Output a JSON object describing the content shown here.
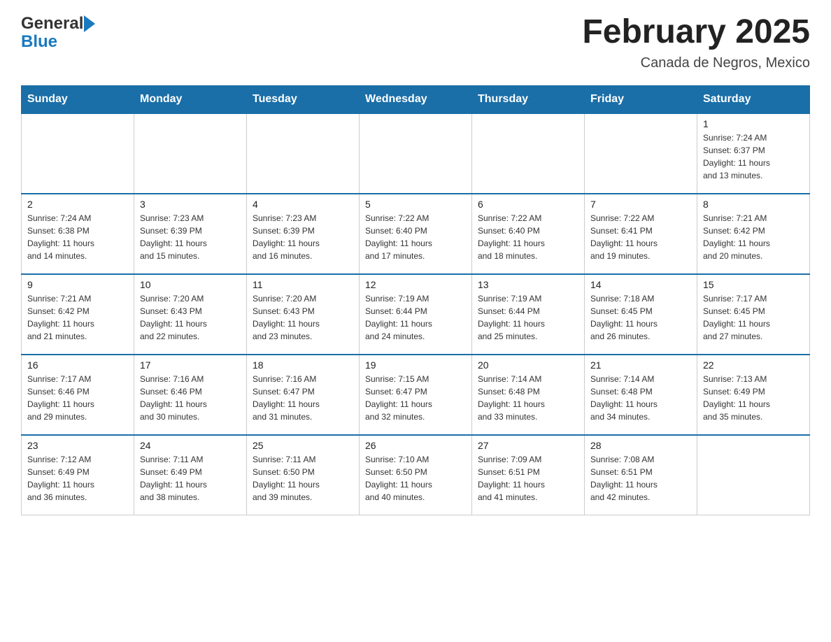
{
  "header": {
    "logo": {
      "general": "General",
      "blue": "Blue"
    },
    "title": "February 2025",
    "location": "Canada de Negros, Mexico"
  },
  "weekdays": [
    "Sunday",
    "Monday",
    "Tuesday",
    "Wednesday",
    "Thursday",
    "Friday",
    "Saturday"
  ],
  "weeks": [
    [
      {
        "day": "",
        "info": ""
      },
      {
        "day": "",
        "info": ""
      },
      {
        "day": "",
        "info": ""
      },
      {
        "day": "",
        "info": ""
      },
      {
        "day": "",
        "info": ""
      },
      {
        "day": "",
        "info": ""
      },
      {
        "day": "1",
        "info": "Sunrise: 7:24 AM\nSunset: 6:37 PM\nDaylight: 11 hours\nand 13 minutes."
      }
    ],
    [
      {
        "day": "2",
        "info": "Sunrise: 7:24 AM\nSunset: 6:38 PM\nDaylight: 11 hours\nand 14 minutes."
      },
      {
        "day": "3",
        "info": "Sunrise: 7:23 AM\nSunset: 6:39 PM\nDaylight: 11 hours\nand 15 minutes."
      },
      {
        "day": "4",
        "info": "Sunrise: 7:23 AM\nSunset: 6:39 PM\nDaylight: 11 hours\nand 16 minutes."
      },
      {
        "day": "5",
        "info": "Sunrise: 7:22 AM\nSunset: 6:40 PM\nDaylight: 11 hours\nand 17 minutes."
      },
      {
        "day": "6",
        "info": "Sunrise: 7:22 AM\nSunset: 6:40 PM\nDaylight: 11 hours\nand 18 minutes."
      },
      {
        "day": "7",
        "info": "Sunrise: 7:22 AM\nSunset: 6:41 PM\nDaylight: 11 hours\nand 19 minutes."
      },
      {
        "day": "8",
        "info": "Sunrise: 7:21 AM\nSunset: 6:42 PM\nDaylight: 11 hours\nand 20 minutes."
      }
    ],
    [
      {
        "day": "9",
        "info": "Sunrise: 7:21 AM\nSunset: 6:42 PM\nDaylight: 11 hours\nand 21 minutes."
      },
      {
        "day": "10",
        "info": "Sunrise: 7:20 AM\nSunset: 6:43 PM\nDaylight: 11 hours\nand 22 minutes."
      },
      {
        "day": "11",
        "info": "Sunrise: 7:20 AM\nSunset: 6:43 PM\nDaylight: 11 hours\nand 23 minutes."
      },
      {
        "day": "12",
        "info": "Sunrise: 7:19 AM\nSunset: 6:44 PM\nDaylight: 11 hours\nand 24 minutes."
      },
      {
        "day": "13",
        "info": "Sunrise: 7:19 AM\nSunset: 6:44 PM\nDaylight: 11 hours\nand 25 minutes."
      },
      {
        "day": "14",
        "info": "Sunrise: 7:18 AM\nSunset: 6:45 PM\nDaylight: 11 hours\nand 26 minutes."
      },
      {
        "day": "15",
        "info": "Sunrise: 7:17 AM\nSunset: 6:45 PM\nDaylight: 11 hours\nand 27 minutes."
      }
    ],
    [
      {
        "day": "16",
        "info": "Sunrise: 7:17 AM\nSunset: 6:46 PM\nDaylight: 11 hours\nand 29 minutes."
      },
      {
        "day": "17",
        "info": "Sunrise: 7:16 AM\nSunset: 6:46 PM\nDaylight: 11 hours\nand 30 minutes."
      },
      {
        "day": "18",
        "info": "Sunrise: 7:16 AM\nSunset: 6:47 PM\nDaylight: 11 hours\nand 31 minutes."
      },
      {
        "day": "19",
        "info": "Sunrise: 7:15 AM\nSunset: 6:47 PM\nDaylight: 11 hours\nand 32 minutes."
      },
      {
        "day": "20",
        "info": "Sunrise: 7:14 AM\nSunset: 6:48 PM\nDaylight: 11 hours\nand 33 minutes."
      },
      {
        "day": "21",
        "info": "Sunrise: 7:14 AM\nSunset: 6:48 PM\nDaylight: 11 hours\nand 34 minutes."
      },
      {
        "day": "22",
        "info": "Sunrise: 7:13 AM\nSunset: 6:49 PM\nDaylight: 11 hours\nand 35 minutes."
      }
    ],
    [
      {
        "day": "23",
        "info": "Sunrise: 7:12 AM\nSunset: 6:49 PM\nDaylight: 11 hours\nand 36 minutes."
      },
      {
        "day": "24",
        "info": "Sunrise: 7:11 AM\nSunset: 6:49 PM\nDaylight: 11 hours\nand 38 minutes."
      },
      {
        "day": "25",
        "info": "Sunrise: 7:11 AM\nSunset: 6:50 PM\nDaylight: 11 hours\nand 39 minutes."
      },
      {
        "day": "26",
        "info": "Sunrise: 7:10 AM\nSunset: 6:50 PM\nDaylight: 11 hours\nand 40 minutes."
      },
      {
        "day": "27",
        "info": "Sunrise: 7:09 AM\nSunset: 6:51 PM\nDaylight: 11 hours\nand 41 minutes."
      },
      {
        "day": "28",
        "info": "Sunrise: 7:08 AM\nSunset: 6:51 PM\nDaylight: 11 hours\nand 42 minutes."
      },
      {
        "day": "",
        "info": ""
      }
    ]
  ]
}
